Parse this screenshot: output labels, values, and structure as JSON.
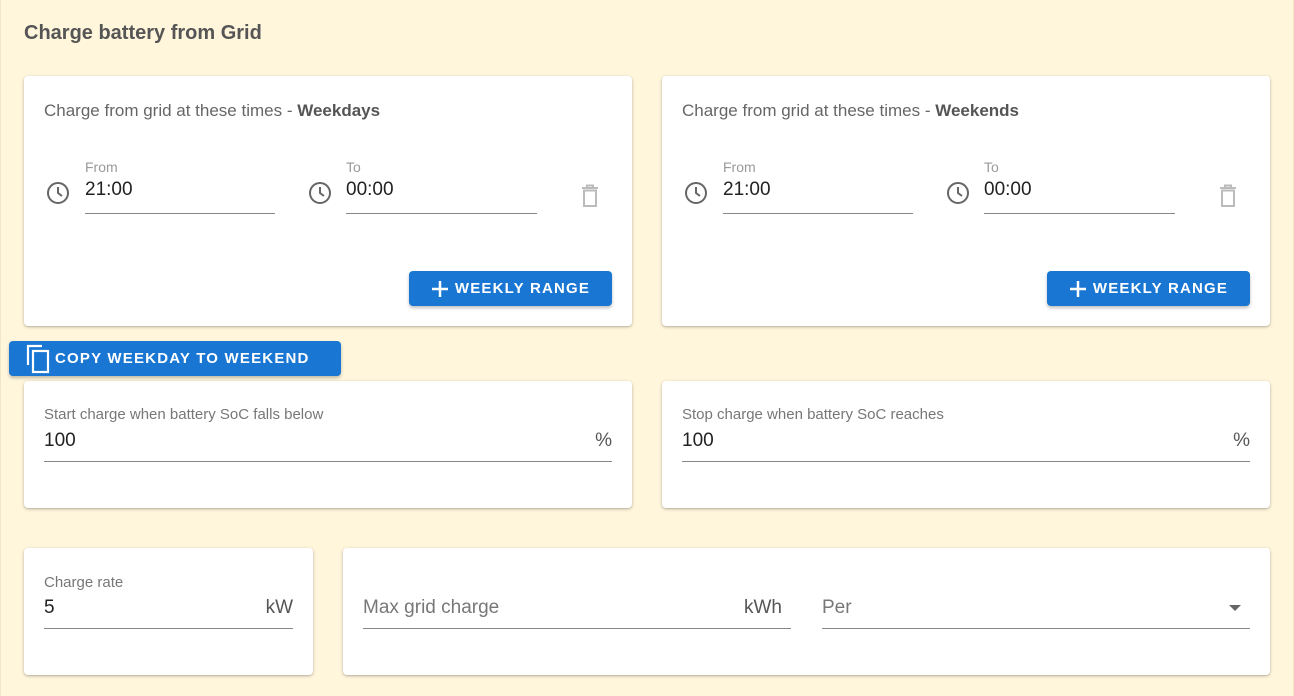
{
  "section": {
    "title": "Charge battery from Grid"
  },
  "weekdays": {
    "heading_prefix": "Charge from grid at these times - ",
    "heading_bold": "Weekdays",
    "from_label": "From",
    "from_value": "21:00",
    "to_label": "To",
    "to_value": "00:00",
    "add_button": "WEEKLY RANGE"
  },
  "weekends": {
    "heading_prefix": "Charge from grid at these times - ",
    "heading_bold": "Weekends",
    "from_label": "From",
    "from_value": "21:00",
    "to_label": "To",
    "to_value": "00:00",
    "add_button": "WEEKLY RANGE"
  },
  "copy_button": "COPY WEEKDAY TO WEEKEND",
  "start_charge": {
    "label": "Start charge when battery SoC falls below",
    "value": "100",
    "unit": "%"
  },
  "stop_charge": {
    "label": "Stop charge when battery SoC reaches",
    "value": "100",
    "unit": "%"
  },
  "charge_rate": {
    "label": "Charge rate",
    "value": "5",
    "unit": "kW"
  },
  "max_grid_charge": {
    "placeholder": "Max grid charge",
    "unit": "kWh"
  },
  "per_select": {
    "placeholder": "Per"
  },
  "colors": {
    "background": "#fff6dc",
    "primary": "#1976d2"
  },
  "icons": [
    "clock-icon",
    "trash-icon",
    "plus-icon",
    "copy-icon",
    "dropdown-arrow-icon"
  ]
}
